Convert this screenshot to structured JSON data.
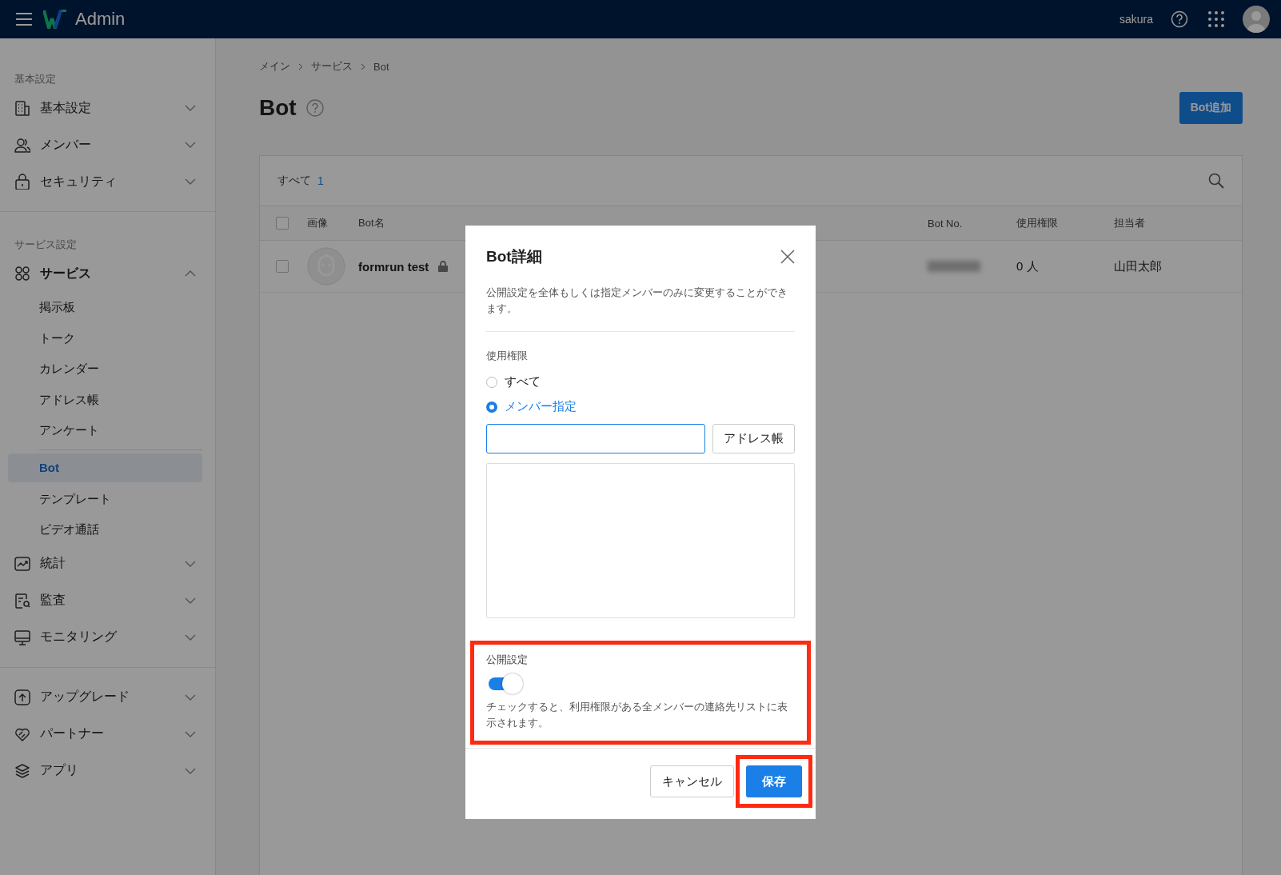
{
  "topbar": {
    "app_name": "Admin",
    "user": "sakura"
  },
  "sidebar": {
    "sections": [
      {
        "label": "基本設定",
        "items": [
          {
            "kind": "building",
            "label": "基本設定",
            "expanded": false
          },
          {
            "kind": "people",
            "label": "メンバー",
            "expanded": false
          },
          {
            "kind": "lock",
            "label": "セキュリティ",
            "expanded": false
          }
        ]
      },
      {
        "label": "サービス設定",
        "items": [
          {
            "kind": "grid",
            "label": "サービス",
            "expanded": true,
            "children": [
              {
                "label": "掲示板",
                "selected": false
              },
              {
                "label": "トーク",
                "selected": false
              },
              {
                "label": "カレンダー",
                "selected": false
              },
              {
                "label": "アドレス帳",
                "selected": false
              },
              {
                "label": "アンケート",
                "selected": false,
                "divider_after": true
              },
              {
                "label": "Bot",
                "selected": true
              },
              {
                "label": "テンプレート",
                "selected": false
              },
              {
                "label": "ビデオ通話",
                "selected": false
              }
            ]
          },
          {
            "kind": "chart",
            "label": "統計",
            "expanded": false
          },
          {
            "kind": "audit",
            "label": "監査",
            "expanded": false
          },
          {
            "kind": "monitor",
            "label": "モニタリング",
            "expanded": false
          }
        ]
      },
      {
        "items": [
          {
            "kind": "upgrade",
            "label": "アップグレード",
            "expanded": false
          },
          {
            "kind": "heart",
            "label": "パートナー",
            "expanded": false
          },
          {
            "kind": "layers",
            "label": "アプリ",
            "expanded": false
          }
        ]
      }
    ]
  },
  "breadcrumb": [
    "メイン",
    "サービス",
    "Bot"
  ],
  "page": {
    "title": "Bot",
    "add_button": "Bot追加"
  },
  "table": {
    "filter": "すべて",
    "count": "1",
    "header_checked": false,
    "columns": [
      {
        "label": "画像"
      },
      {
        "label": "Bot名"
      },
      {
        "label": "Bot No."
      },
      {
        "label": "使用権限"
      },
      {
        "label": "担当者"
      }
    ],
    "rows": [
      {
        "checked": false,
        "name": "formrun test",
        "locked": true,
        "usage": "0 人",
        "owner": "山田太郎"
      }
    ]
  },
  "modal": {
    "title": "Bot詳細",
    "description": "公開設定を全体もしくは指定メンバーのみに変更することができます。",
    "permission_label": "使用権限",
    "options": [
      {
        "label": "すべて",
        "selected": false
      },
      {
        "label": "メンバー指定",
        "selected": true
      }
    ],
    "address_button": "アドレス帳",
    "public": {
      "label": "公開設定",
      "on": true,
      "note": "チェックすると、利用権限がある全メンバーの連絡先リストに表示されます。",
      "highlighted": true
    },
    "cancel_button": "キャンセル",
    "save_button": {
      "label": "保存",
      "highlighted": true
    }
  }
}
